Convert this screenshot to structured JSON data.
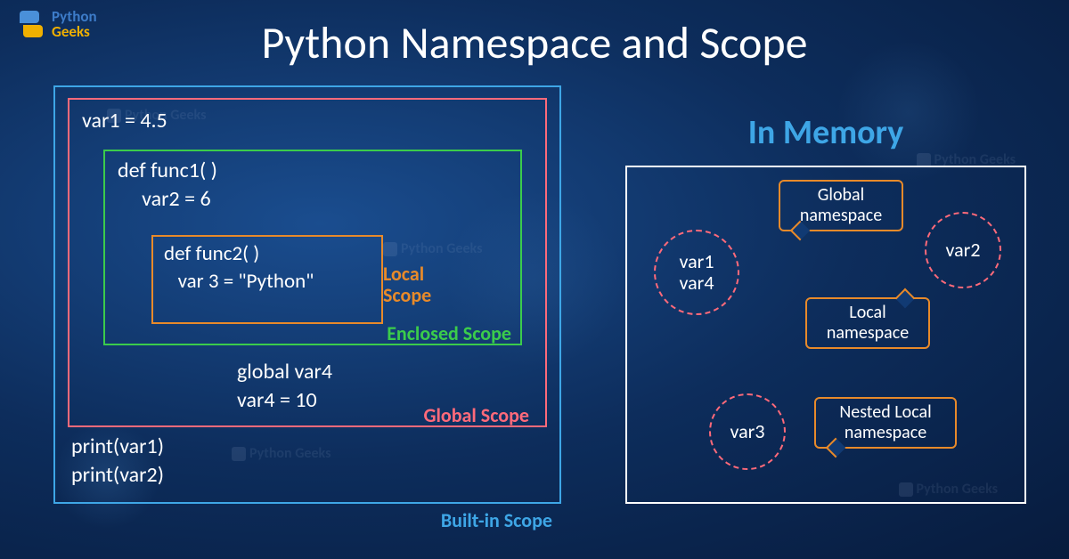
{
  "logo": {
    "line1": "Python",
    "line2": "Geeks"
  },
  "title": "Python Namespace and Scope",
  "code": {
    "global_var": "var1 = 4.5",
    "func1_def": "def func1( )",
    "func1_body": "     var2 = 6",
    "func2_def": "def func2( )",
    "func2_body": "   var 3 = \"Python\"",
    "global_stmt": "global var4",
    "var4_assign": "var4 = 10",
    "print1": "print(var1)",
    "print2": "print(var2)"
  },
  "scopes": {
    "local": "Local Scope",
    "enclosed": "Enclosed Scope",
    "global": "Global Scope",
    "builtin": "Built-in Scope"
  },
  "memory": {
    "heading": "In Memory",
    "circle1_line1": "var1",
    "circle1_line2": "var4",
    "circle2": "var2",
    "circle3": "var3",
    "bubble_global": "Global namespace",
    "bubble_local": "Local namespace",
    "bubble_nested": "Nested Local namespace"
  },
  "watermark": "Python Geeks"
}
